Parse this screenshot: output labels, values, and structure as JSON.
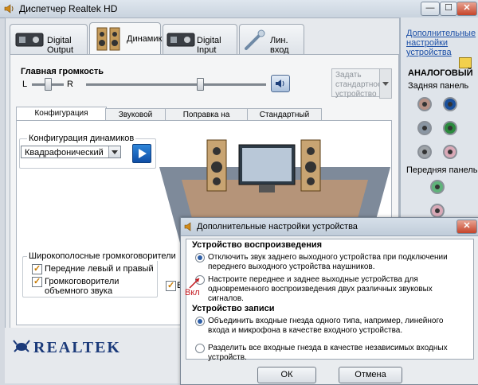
{
  "window": {
    "title": "Диспетчер Realtek HD",
    "controls": [
      "—",
      "☐",
      "✕"
    ]
  },
  "device_tabs": [
    {
      "label": "Digital Output",
      "active": false
    },
    {
      "label": "Динамики",
      "active": true
    },
    {
      "label": "Digital Input",
      "active": false
    },
    {
      "label": "Лин. вход",
      "active": false
    }
  ],
  "volume": {
    "label": "Главная громкость",
    "left": "L",
    "right": "R",
    "balance": 0.5,
    "level": 0.98
  },
  "set_default": "Задать стандартное устройство",
  "sub_tabs": [
    {
      "label": "Конфигурация динамиков",
      "active": true
    },
    {
      "label": "Звуковой эффект",
      "active": false
    },
    {
      "label": "Поправка на помещение",
      "active": false
    },
    {
      "label": "Стандартный формат",
      "active": false
    }
  ],
  "speaker_config": {
    "group_label": "Конфигурация динамиков",
    "selected": "Квадрафонический"
  },
  "wideband": {
    "label": "Широкополосные громкоговорители",
    "items": [
      {
        "label": "Передние левый и правый",
        "checked": true
      },
      {
        "label": "Громкоговорители объемного звука",
        "checked": true
      }
    ],
    "partial_label": "В"
  },
  "right_panel": {
    "link": "Дополнительные настройки устройства",
    "analog": "АНАЛОГОВЫЙ",
    "back": "Задняя панель",
    "front": "Передняя панель"
  },
  "jack_colors": {
    "row1": [
      "#b59085",
      "#1a4f9a"
    ],
    "row2": [
      "#8a96a3",
      "#2b8a3e"
    ],
    "row3": [
      "#9ea3a8",
      "#d9a9b7"
    ],
    "front1": "#5fb37a",
    "front2": "#d9a9b7"
  },
  "brand": "REALTEK",
  "dialog": {
    "title": "Дополнительные настройки устройства",
    "playback_title": "Устройство воспроизведения",
    "playback_opt1": "Отключить звук заднего выходного устройства при подключении переднего выходного устройства наушников.",
    "playback_opt2": "Настроите переднее и заднее выходные устройства для одновременного воспроизведения двух различных звуковых сигналов.",
    "record_title": "Устройство записи",
    "record_opt1": "Объединить входные гнезда одного типа, например, линейного входа и микрофона в качестве входного устройства.",
    "record_opt2": "Разделить все входные гнезда в качестве независимых входных устройств.",
    "ok": "ОК",
    "cancel": "Отмена"
  },
  "annotation": "Вкл"
}
